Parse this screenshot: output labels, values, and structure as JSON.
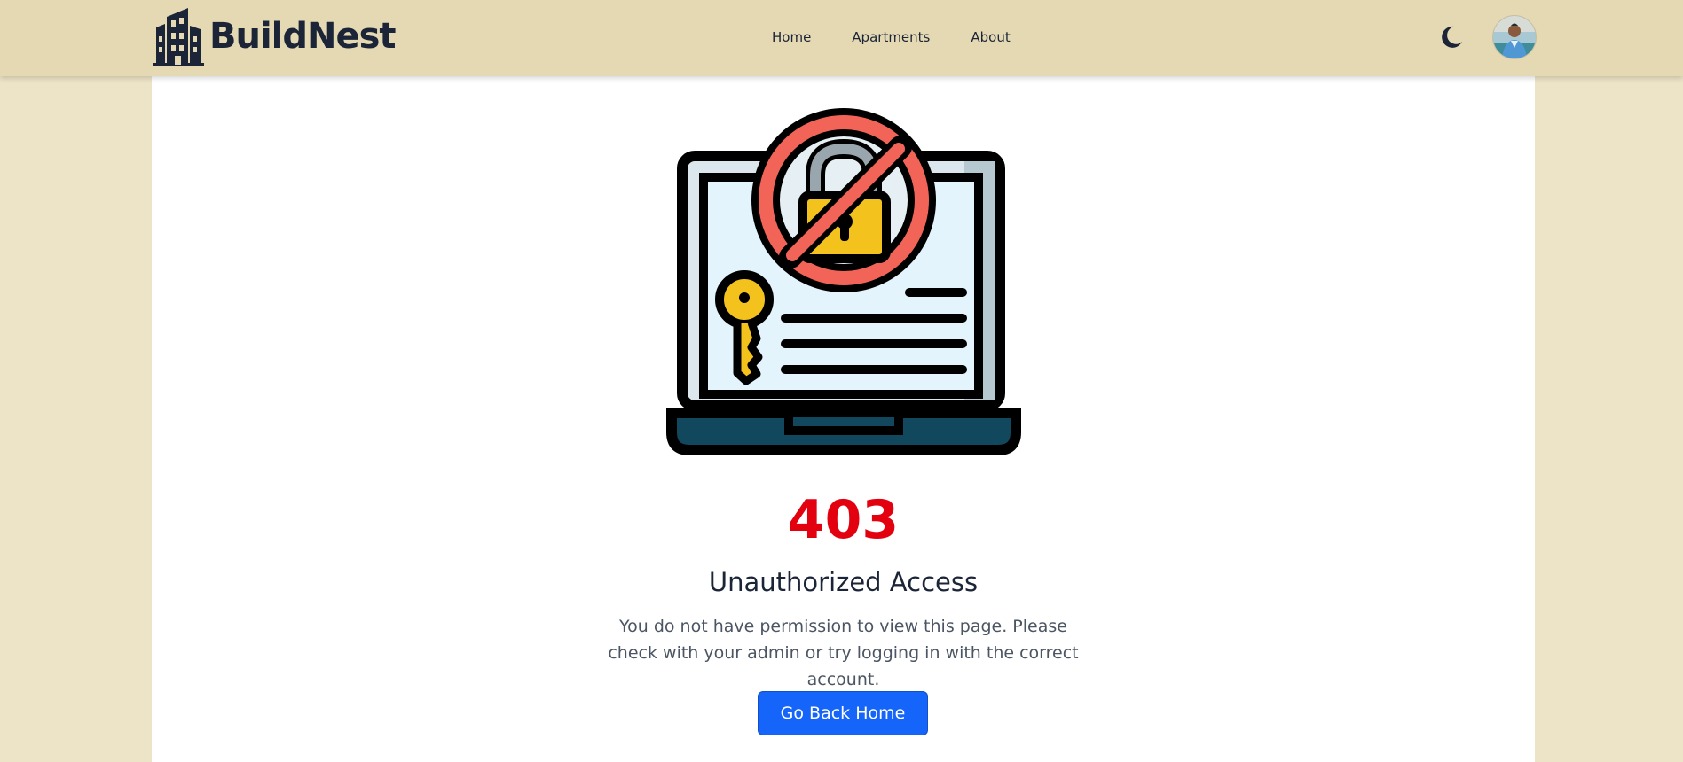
{
  "brand": {
    "name": "BuildNest",
    "icon": "building-icon"
  },
  "nav": {
    "items": [
      {
        "label": "Home"
      },
      {
        "label": "Apartments"
      },
      {
        "label": "About"
      }
    ]
  },
  "header_actions": {
    "theme_toggle_icon": "moon-icon",
    "avatar_icon": "user-avatar"
  },
  "error": {
    "code": "403",
    "title": "Unauthorized Access",
    "message": "You do not have permission to view this page. Please check with your admin or try logging in with the correct account.",
    "button_label": "Go Back Home",
    "illustration_icon": "locked-laptop-icon"
  },
  "colors": {
    "page_background": "#ede3c6",
    "navbar_background": "#e5d9b4",
    "brand_text": "#1b2537",
    "error_code": "#e3000f",
    "button_background": "#1565fa",
    "button_text": "#ffffff"
  }
}
